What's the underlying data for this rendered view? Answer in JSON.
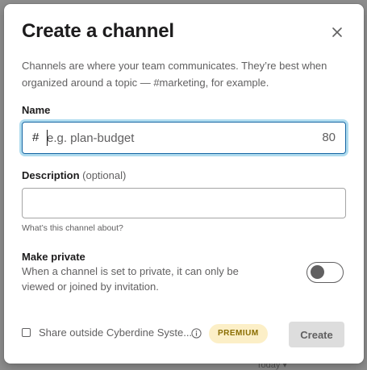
{
  "dialog": {
    "title": "Create a channel",
    "intro": "Channels are where your team communicates. They’re best when organized around a topic — #marketing, for example."
  },
  "name_field": {
    "label": "Name",
    "prefix": "#",
    "placeholder": "e.g. plan-budget",
    "value": "",
    "char_remaining": "80"
  },
  "description_field": {
    "label": "Description",
    "optional_label": "(optional)",
    "value": "",
    "hint": "What’s this channel about?"
  },
  "make_private": {
    "title": "Make private",
    "description": "When a channel is set to private, it can only be viewed or joined by invitation.",
    "enabled": false
  },
  "footer": {
    "share_label": "Share outside Cyberdine Syste...",
    "premium_badge": "PREMIUM",
    "create_label": "Create"
  },
  "backdrop": {
    "today_label": "Today ▾"
  },
  "colors": {
    "focus_blue": "#1264a3",
    "premium_bg": "#fcefc7",
    "disabled_button": "#dddddd"
  },
  "icons": {
    "close": "close-icon",
    "info": "info-icon"
  }
}
